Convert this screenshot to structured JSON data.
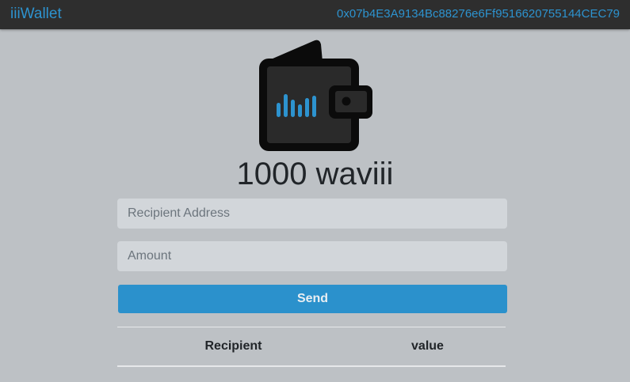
{
  "navbar": {
    "brand": "iiiWallet",
    "address": "0x07b4E3A9134Bc88276e6Ff9516620755144CEC79"
  },
  "wallet": {
    "icon": "wallet-icon",
    "balance": "1000 waviii"
  },
  "form": {
    "recipient_placeholder": "Recipient Address",
    "amount_placeholder": "Amount",
    "send_label": "Send"
  },
  "table": {
    "columns": [
      "Recipient",
      "value"
    ]
  },
  "colors": {
    "accent": "#2b91cc",
    "navbar": "#2e2e2e",
    "background": "#bdc1c5"
  }
}
